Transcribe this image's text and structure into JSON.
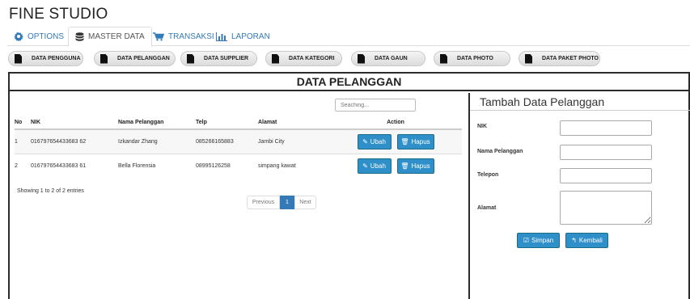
{
  "app": {
    "title": "FINE STUDIO"
  },
  "nav": {
    "tabs": [
      {
        "label": "OPTIONS",
        "icon": "gear-icon"
      },
      {
        "label": "MASTER DATA",
        "icon": "database-icon"
      },
      {
        "label": "TRANSAKSI",
        "icon": "cart-icon"
      },
      {
        "label": "LAPORAN",
        "icon": "bar-chart-icon"
      }
    ],
    "active": "MASTER DATA"
  },
  "subnav": {
    "items": [
      {
        "label": "DATA PENGGUNA"
      },
      {
        "label": "DATA PELANGGAN"
      },
      {
        "label": "DATA SUPPLIER"
      },
      {
        "label": "DATA KATEGORI"
      },
      {
        "label": "DATA GAUN"
      },
      {
        "label": "DATA PHOTO"
      },
      {
        "label": "DATA PAKET PHOTO"
      }
    ]
  },
  "main": {
    "title": "DATA PELANGGAN",
    "search_placeholder": "Seaching...",
    "table": {
      "headers": [
        "No",
        "NIK",
        "Nama Pelanggan",
        "Telp",
        "Alamat",
        "Action"
      ],
      "rows": [
        {
          "no": "1",
          "nik": "016797654433683 62",
          "nama": "Izkandar Zhang",
          "telp": "085266165883",
          "alamat": "Jambi City"
        },
        {
          "no": "2",
          "nik": "016797654433683 61",
          "nama": "Bella Florensia",
          "telp": "08995126258",
          "alamat": "simpang kawat"
        }
      ],
      "action_labels": {
        "edit": "Ubah",
        "delete": "Hapus"
      }
    },
    "info": "Showing 1 to 2 of 2 entries",
    "pagination": {
      "previous": "Previous",
      "current": "1",
      "next": "Next"
    }
  },
  "form": {
    "title": "Tambah Data Pelanggan",
    "fields": {
      "nik": "NIK",
      "nama": "Nama Pelanggan",
      "telepon": "Telepon",
      "alamat": "Alamat"
    },
    "buttons": {
      "save": "Simpan",
      "back": "Kembali"
    }
  },
  "colors": {
    "primary": "#2f8fc9",
    "link": "#337ab7",
    "border": "#2b2b2b"
  }
}
